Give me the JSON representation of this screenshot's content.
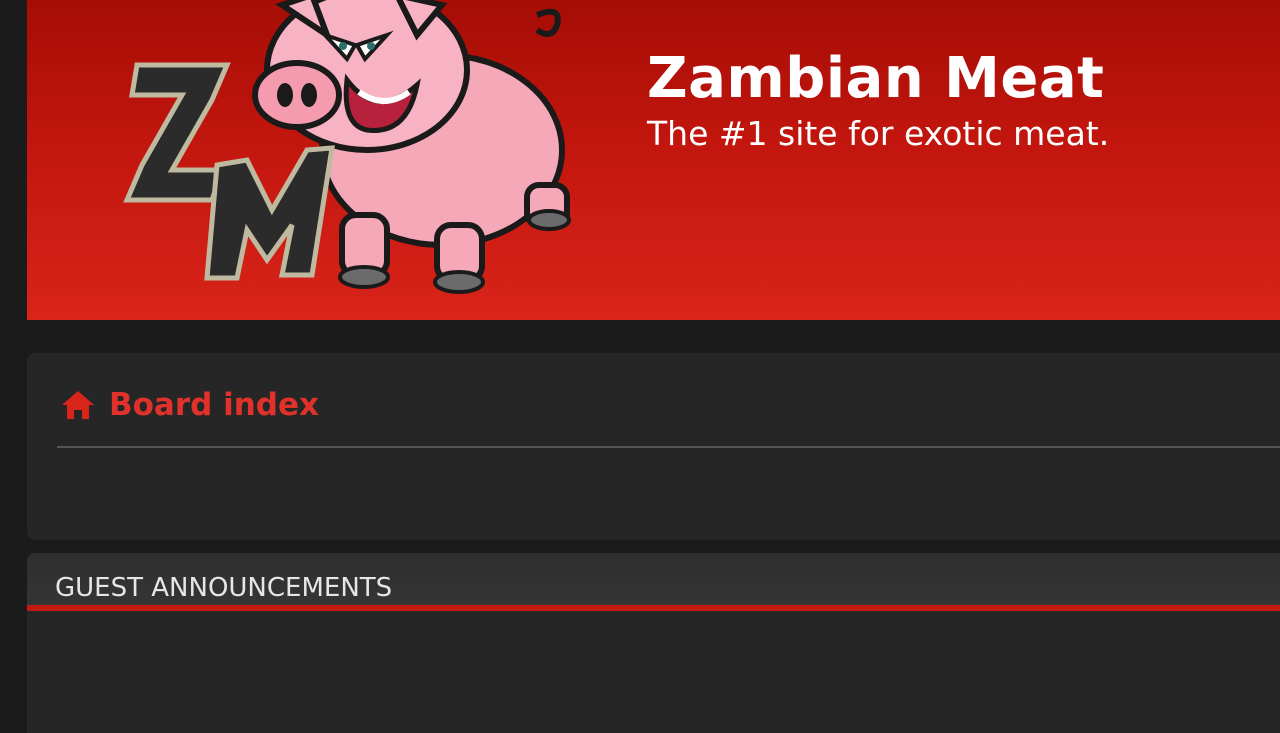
{
  "header": {
    "logo_letters": "ZM",
    "title": "Zambian Meat",
    "tagline": "The #1 site for exotic meat."
  },
  "navbar": {
    "breadcrumb_label": "Board index",
    "home_icon": "home-icon"
  },
  "forum_section": {
    "title": "GUEST ANNOUNCEMENTS"
  },
  "colors": {
    "background": "#1b1b1b",
    "header_red_top": "#a50d05",
    "header_red_bottom": "#d9241a",
    "panel": "#262626",
    "link_red": "#e0322a",
    "accent_rule": "#c41a12"
  }
}
